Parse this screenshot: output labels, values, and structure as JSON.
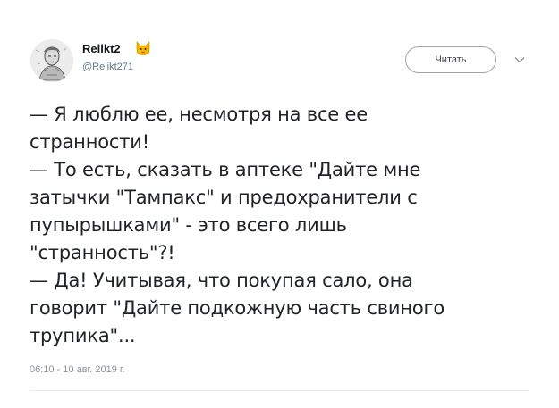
{
  "author": {
    "display_name": "Relikt2",
    "handle": "@Relikt271",
    "avatar_icon": "sketch-portrait-avatar",
    "name_emoji": "cat-face-icon"
  },
  "actions": {
    "follow_label": "Читать",
    "menu_icon": "chevron-down-icon"
  },
  "tweet": {
    "lines": [
      "— Я люблю ее, несмотря на все ее",
      "странности!",
      "— То есть, сказать в аптеке \"Дайте мне",
      "затычки \"Тампакс\" и предохранители с",
      "пупырышками\" - это всего лишь",
      "\"странность\"?!",
      "— Да! Учитывая, что покупая сало, она",
      "говорит \"Дайте подкожную часть свиного",
      "трупика\"..."
    ],
    "timestamp": "06:10 - 10 авг. 2019 г."
  },
  "colors": {
    "text": "#1f2328",
    "secondary": "#657786",
    "border": "#9da5ad",
    "emoji": "#f5b400"
  }
}
